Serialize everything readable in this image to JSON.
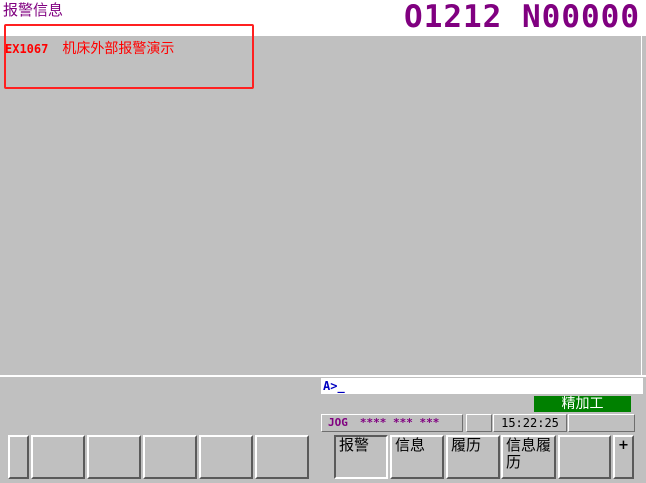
{
  "header": {
    "screen_title": "报警信息",
    "program_number": "O1212 N00000"
  },
  "alarm": {
    "code": "EX1067",
    "message": "机床外部报警演示"
  },
  "input_line": {
    "prompt": "A>_"
  },
  "status": {
    "finish_label": "精加工",
    "mode": "JOG",
    "mode_indicator": "**** *** ***",
    "clock": "15:22:25"
  },
  "softkeys": {
    "alarm": "报警",
    "info": "信息",
    "history": "履历",
    "info_history": "信息履历",
    "next_arrow": "+"
  },
  "colors": {
    "background": "#c0c0c0",
    "title_purple": "#800080",
    "alarm_red": "#ff0000",
    "status_green": "#008000",
    "input_blue": "#0000c0"
  }
}
